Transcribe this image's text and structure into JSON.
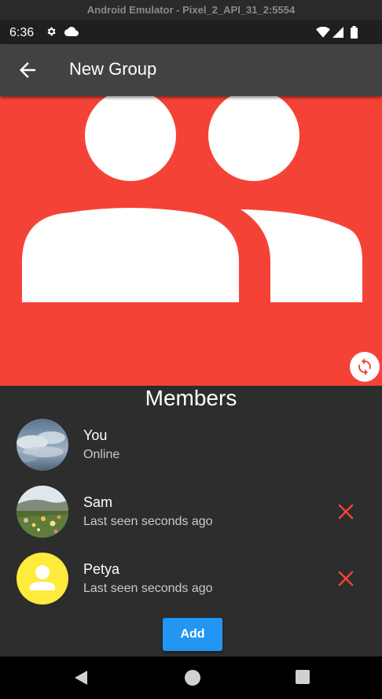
{
  "window_title": "Android Emulator - Pixel_2_API_31_2:5554",
  "status_bar": {
    "time": "6:36",
    "icons": [
      "settings-icon",
      "cloud-icon",
      "wifi-icon",
      "signal-icon",
      "battery-icon"
    ]
  },
  "app_bar": {
    "back_icon": "arrow-back-icon",
    "title": "New Group"
  },
  "hero": {
    "background_color": "#f44336",
    "icon": "group-icon",
    "refresh_icon": "refresh-icon"
  },
  "members": {
    "title": "Members",
    "items": [
      {
        "name": "You",
        "status": "Online",
        "avatar": "cloudy-sky-photo",
        "removable": false
      },
      {
        "name": "Sam",
        "status": "Last seen seconds ago",
        "avatar": "flower-meadow-photo",
        "removable": true
      },
      {
        "name": "Petya",
        "status": "Last seen seconds ago",
        "avatar": "person-placeholder-icon",
        "removable": true
      }
    ]
  },
  "add_button": {
    "label": "Add"
  },
  "colors": {
    "accent": "#2196f3",
    "danger": "#f44336",
    "app_bar": "#424242",
    "background": "#2d2d2d",
    "placeholder_avatar": "#ffeb3b"
  },
  "nav_bar": {
    "icons": [
      "nav-back-icon",
      "nav-home-icon",
      "nav-recents-icon"
    ]
  }
}
